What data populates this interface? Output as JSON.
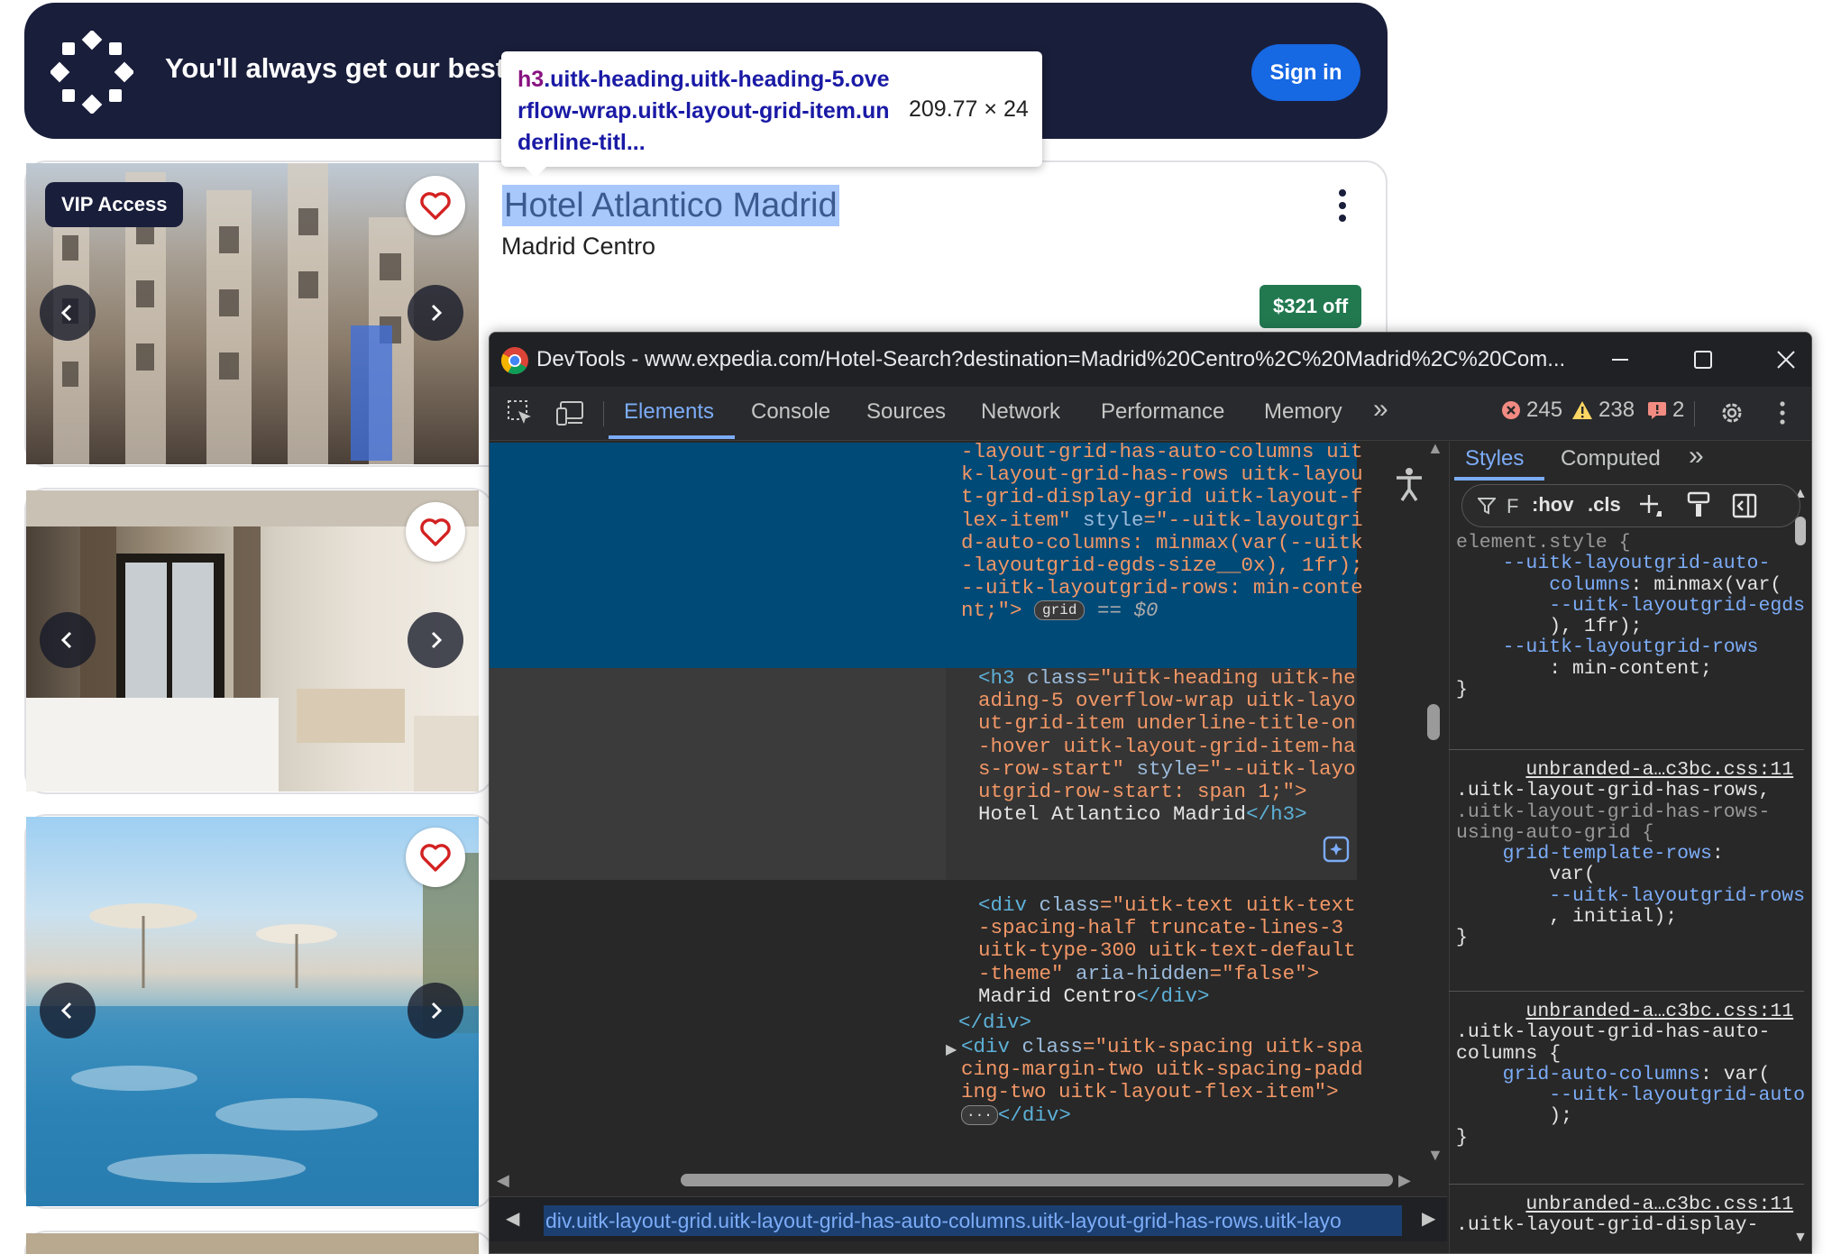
{
  "banner": {
    "text": "You'll always get our best",
    "signin_label": "Sign in"
  },
  "tooltip": {
    "selector_tag": "h3",
    "selector_rest": ".uitk-heading.uitk-heading-5.overflow-wrap.uitk-layout-grid-item.underline-titl...",
    "size": "209.77 × 24"
  },
  "hotel": {
    "vip_label": "VIP Access",
    "name": "Hotel Atlantico Madrid",
    "location": "Madrid Centro",
    "discount": "$321 off"
  },
  "devtools": {
    "title": "DevTools - www.expedia.com/Hotel-Search?destination=Madrid%20Centro%2C%20Madrid%2C%20Com...",
    "tabs": [
      "Elements",
      "Console",
      "Sources",
      "Network",
      "Performance",
      "Memory"
    ],
    "more_tabs": "»",
    "errors": "245",
    "warnings": "238",
    "issues": "2",
    "grid_badge": "grid",
    "dollar_zero": "== $0",
    "breadcrumb": "div.uitk-layout-grid.uitk-layout-grid-has-auto-columns.uitk-layout-grid-has-rows.uitk-layo",
    "dom_lines": {
      "l1": "-layout-grid-has-auto-columns uit",
      "l2": "k-layout-grid-has-rows uitk-layou",
      "l3": "t-grid-display-grid uitk-layout-f",
      "l4a": "lex-item\" ",
      "l4b": "style",
      "l4c": "=\"--uitk-layoutgri",
      "l5": "d-auto-columns: minmax(var(--uitk",
      "l6": "-layoutgrid-egds-size__0x), 1fr);",
      "l7": "--uitk-layoutgrid-rows: min-conte",
      "l8": "nt;\">",
      "h3_1a": "<h3 ",
      "h3_1b": "class",
      "h3_1c": "=\"uitk-heading uitk-he",
      "h3_2": "ading-5 overflow-wrap uitk-layo",
      "h3_3": "ut-grid-item underline-title-on",
      "h3_4": "-hover uitk-layout-grid-item-ha",
      "h3_5a": "s-row-start\" ",
      "h3_5b": "style",
      "h3_5c": "=\"--uitk-layo",
      "h3_6": "utgrid-row-start: span 1;\">",
      "h3_7a": "Hotel Atlantico Madrid",
      "h3_7b": "</h3>",
      "div_1a": "<div ",
      "div_1b": "class",
      "div_1c": "=\"uitk-text uitk-text",
      "div_2": "-spacing-half truncate-lines-3",
      "div_3": "uitk-type-300 uitk-text-default",
      "div_4a": "-theme\" ",
      "div_4b": "aria-hidden",
      "div_4c": "=\"false\">",
      "div_5a": "Madrid Centro",
      "div_5b": "</div>",
      "close_div": "</div>",
      "sp_1a": "<div ",
      "sp_1b": "class",
      "sp_1c": "=\"uitk-spacing uitk-spa",
      "sp_2": "cing-margin-two uitk-spacing-padd",
      "sp_3": "ing-two uitk-layout-flex-item\">",
      "sp_4": "</div>"
    },
    "styles": {
      "tabs": [
        "Styles",
        "Computed"
      ],
      "filter": "F",
      "hov": ":hov",
      "cls": ".cls",
      "rule1": {
        "selector": "element.style {",
        "p1": "--uitk-layoutgrid-auto-",
        "p1b": "columns",
        "v1": ": minmax(var(",
        "v1b": "--uitk-layoutgrid-egds",
        "v1c": "), 1fr);",
        "p2": "--uitk-layoutgrid-rows",
        "v2": ": min-content;",
        "close": "}"
      },
      "rule2": {
        "source": "unbranded-a…c3bc.css:11",
        "sel1": ".uitk-layout-grid-has-rows,",
        "sel2": ".uitk-layout-grid-has-rows-",
        "sel3": "using-auto-grid {",
        "prop": "grid-template-rows",
        "v1": "var(",
        "v2": "--uitk-layoutgrid-rows",
        "v3": ", initial);",
        "close": "}"
      },
      "rule3": {
        "source": "unbranded-a…c3bc.css:11",
        "sel1": ".uitk-layout-grid-has-auto-",
        "sel2": "columns {",
        "prop": "grid-auto-columns",
        "v1": "var(",
        "v2": "--uitk-layoutgrid-auto",
        "v3": ");",
        "close": "}"
      },
      "rule4": {
        "source": "unbranded-a…c3bc.css:11",
        "sel1": ".uitk-layout-grid-display-"
      }
    }
  },
  "colors": {
    "banner_bg": "#191e3b",
    "signin_bg": "#1668e3",
    "discount_bg": "#227950",
    "devtools_accent": "#7cacf8",
    "selected_row": "#004a77"
  }
}
